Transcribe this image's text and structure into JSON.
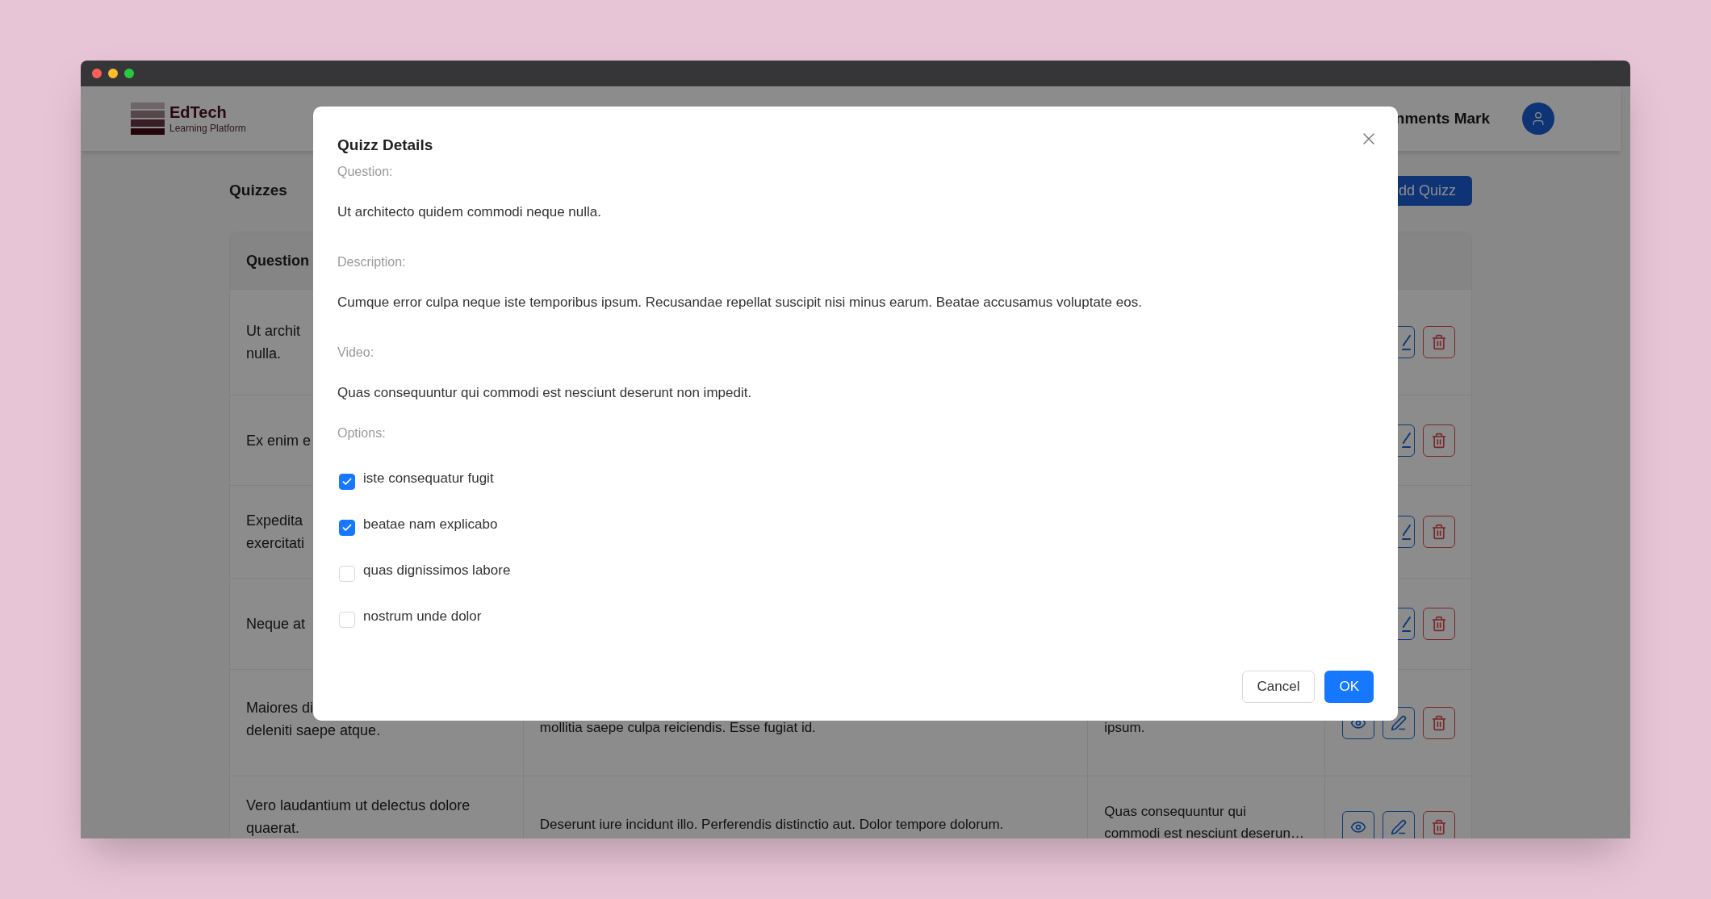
{
  "header": {
    "brand": "EdTech",
    "tagline": "Learning Platform",
    "nav_link": "nments Mark"
  },
  "page": {
    "title": "Quizzes",
    "add_button": "dd Quizz"
  },
  "table": {
    "columns": [
      "Question"
    ],
    "rows": [
      {
        "kind": "behind_dialog",
        "question_lines": [
          "Ut archit",
          "nulla."
        ]
      },
      {
        "kind": "behind_dialog",
        "question_lines": [
          "Ex enim e"
        ]
      },
      {
        "kind": "behind_dialog",
        "question_lines": [
          "Expedita",
          "exercitati"
        ]
      },
      {
        "kind": "behind_dialog",
        "question_lines": [
          "Neque at"
        ]
      },
      {
        "kind": "full",
        "question_lines": [
          "Maiores di",
          "deleniti saepe atque."
        ],
        "description_lines": [
          "mollitia saepe culpa reiciendis. Esse fugiat id."
        ],
        "video_lines": [
          "ipsum."
        ]
      },
      {
        "kind": "full",
        "question_lines": [
          "Vero laudantium ut delectus dolore",
          "quaerat."
        ],
        "description_lines": [
          "Deserunt iure incidunt illo. Perferendis distinctio aut. Dolor tempore dolorum."
        ],
        "video_lines": [
          "Quas consequuntur qui",
          "commodi est nesciunt deserun…"
        ]
      }
    ]
  },
  "dialog": {
    "title": "Quizz Details",
    "fields": [
      {
        "label": "Question:",
        "value": "Ut architecto quidem commodi neque nulla."
      },
      {
        "label": "Description:",
        "value": "Cumque error culpa neque iste temporibus ipsum. Recusandae repellat suscipit nisi minus earum. Beatae accusamus voluptate eos."
      },
      {
        "label": "Video:",
        "value": "Quas consequuntur qui commodi est nesciunt deserunt non impedit."
      }
    ],
    "options_label": "Options:",
    "options": [
      {
        "label": "iste consequatur fugit",
        "checked": true
      },
      {
        "label": "beatae nam explicabo",
        "checked": true
      },
      {
        "label": "quas dignissimos labore",
        "checked": false
      },
      {
        "label": "nostrum unde dolor",
        "checked": false
      }
    ],
    "cancel": "Cancel",
    "ok": "OK"
  }
}
